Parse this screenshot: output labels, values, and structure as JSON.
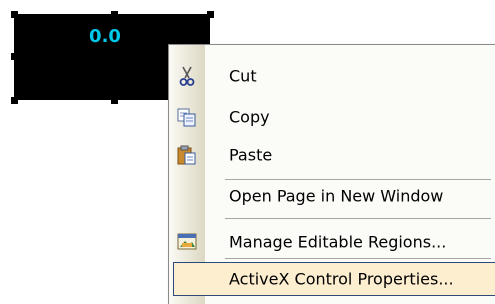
{
  "control": {
    "value_text": "0.0",
    "value_color": "#00c8e8"
  },
  "menu": {
    "items": [
      {
        "label": "Cut",
        "icon": "scissors-icon"
      },
      {
        "label": "Copy",
        "icon": "copy-icon"
      },
      {
        "label": "Paste",
        "icon": "paste-icon"
      },
      {
        "label": "Open Page in New Window",
        "icon": ""
      },
      {
        "label": "Manage Editable Regions...",
        "icon": "editable-regions-icon"
      },
      {
        "label": "ActiveX Control Properties...",
        "icon": ""
      }
    ],
    "selected_index": 5,
    "highlight_color": "#fdeed0",
    "highlight_border": "#2e4a7d"
  }
}
